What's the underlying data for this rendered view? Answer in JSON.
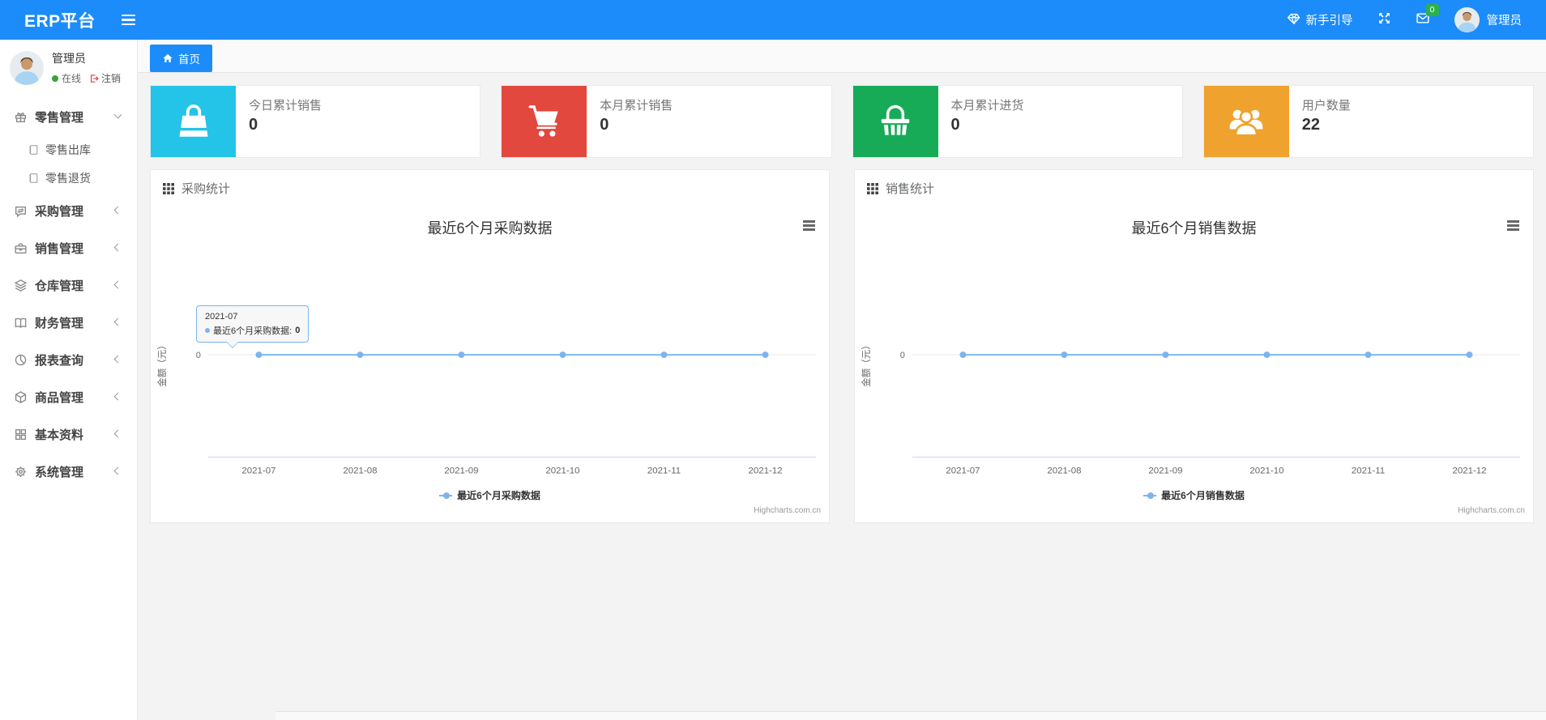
{
  "theme": {
    "accent": "#1b8cfa",
    "badge_green": "#2bb24c",
    "chart_line": "#7cb5ec"
  },
  "navbar": {
    "brand": "ERP平台",
    "guide_label": "新手引导",
    "message_count": "0",
    "username": "管理员"
  },
  "sidebar": {
    "user": {
      "name": "管理员",
      "status": "在线",
      "logout": "注销"
    },
    "menu": [
      {
        "label": "零售管理",
        "icon": "gift-icon",
        "state": "expanded",
        "children": [
          {
            "label": "零售出库",
            "icon": "journal-icon"
          },
          {
            "label": "零售退货",
            "icon": "journal-icon"
          }
        ]
      },
      {
        "label": "采购管理",
        "icon": "chat-sync-icon",
        "state": "collapsed"
      },
      {
        "label": "销售管理",
        "icon": "briefcase-icon",
        "state": "collapsed"
      },
      {
        "label": "仓库管理",
        "icon": "layers-icon",
        "state": "collapsed"
      },
      {
        "label": "财务管理",
        "icon": "book-open-icon",
        "state": "collapsed"
      },
      {
        "label": "报表查询",
        "icon": "pie-chart-icon",
        "state": "collapsed"
      },
      {
        "label": "商品管理",
        "icon": "box-icon",
        "state": "collapsed"
      },
      {
        "label": "基本资料",
        "icon": "grid-icon",
        "state": "collapsed"
      },
      {
        "label": "系统管理",
        "icon": "gear-icon",
        "state": "collapsed"
      }
    ]
  },
  "tabs": {
    "home": "首页"
  },
  "stat_cards": [
    {
      "label": "今日累计销售",
      "value": "0",
      "color": "#24c3e8",
      "icon": "bag-icon"
    },
    {
      "label": "本月累计销售",
      "value": "0",
      "color": "#e2483d",
      "icon": "cart-icon"
    },
    {
      "label": "本月累计进货",
      "value": "0",
      "color": "#17ab57",
      "icon": "basket-icon"
    },
    {
      "label": "用户数量",
      "value": "22",
      "color": "#f0a22e",
      "icon": "users-icon"
    }
  ],
  "panels": [
    {
      "header": "采购统计"
    },
    {
      "header": "销售统计"
    }
  ],
  "chart_data": [
    {
      "type": "line",
      "title": "最近6个月采购数据",
      "categories": [
        "2021-07",
        "2021-08",
        "2021-09",
        "2021-10",
        "2021-11",
        "2021-12"
      ],
      "series": [
        {
          "name": "最近6个月采购数据",
          "values": [
            0,
            0,
            0,
            0,
            0,
            0
          ]
        }
      ],
      "xlabel": "",
      "ylabel": "金额（元）",
      "ylim": [
        -1,
        1
      ],
      "ytick": "0",
      "grid": false,
      "legend_position": "bottom",
      "line_color": "#7cb5ec",
      "credit": "Highcharts.com.cn",
      "tooltip": {
        "title": "2021-07",
        "label": "最近6个月采购数据:",
        "value": "0"
      }
    },
    {
      "type": "line",
      "title": "最近6个月销售数据",
      "categories": [
        "2021-07",
        "2021-08",
        "2021-09",
        "2021-10",
        "2021-11",
        "2021-12"
      ],
      "series": [
        {
          "name": "最近6个月销售数据",
          "values": [
            0,
            0,
            0,
            0,
            0,
            0
          ]
        }
      ],
      "xlabel": "",
      "ylabel": "金额（元）",
      "ylim": [
        -1,
        1
      ],
      "ytick": "0",
      "grid": false,
      "legend_position": "bottom",
      "line_color": "#7cb5ec",
      "credit": "Highcharts.com.cn"
    }
  ]
}
